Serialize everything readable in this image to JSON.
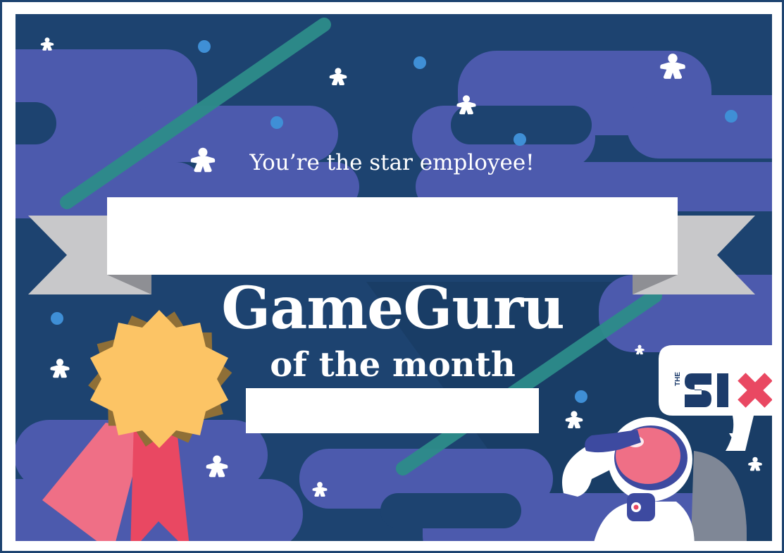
{
  "certificate": {
    "tagline": "You’re the star employee!",
    "title": "GameGuru",
    "subtitle": "of the month",
    "name_value": "",
    "date_value": ""
  },
  "logo": {
    "text": "THE SIX"
  },
  "colors": {
    "background": "#1d4370",
    "cloud": "#4c5aad",
    "ribbon": "#c8c8ca",
    "medal": "#fcc465",
    "ribbon_pink": "#ef6f86",
    "comet": "#2d8c8a",
    "logo_navy": "#1d3c6b",
    "logo_red": "#e94862"
  },
  "icons": [
    "meeple-star-icon",
    "medal-icon",
    "astronaut-icon",
    "comet-icon",
    "speech-bubble-icon"
  ]
}
